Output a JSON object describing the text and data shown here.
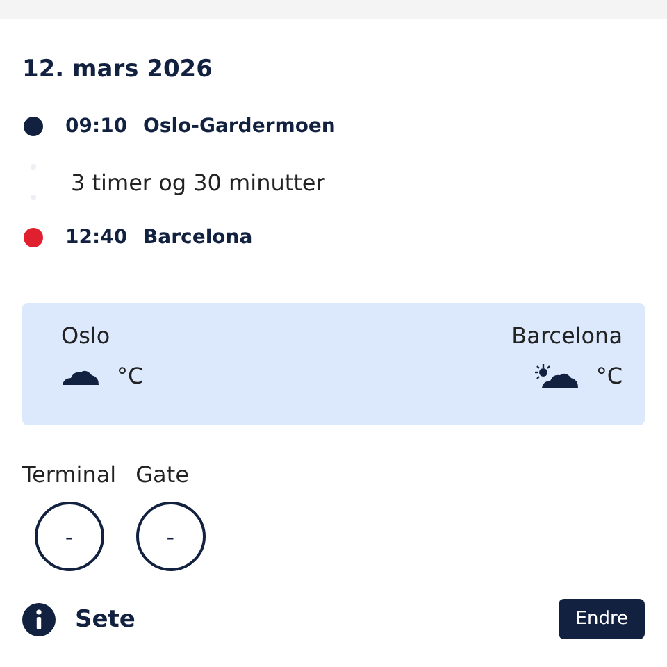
{
  "date": "12. mars 2026",
  "timeline": [
    {
      "kind": "stop",
      "time": "09:10",
      "place": "Oslo-Gardermoen",
      "color": "#12213f"
    },
    {
      "kind": "duration",
      "text": "3 timer og 30 minutter"
    },
    {
      "kind": "stop",
      "time": "12:40",
      "place": "Barcelona",
      "color": "#e0202e"
    }
  ],
  "weather": [
    {
      "kind": "cloud",
      "city": "Oslo",
      "unit": "°C"
    },
    {
      "kind": "suncloud",
      "city": "Barcelona",
      "unit": "°C"
    }
  ],
  "gates": [
    {
      "label": "Terminal",
      "value": "-"
    },
    {
      "label": "Gate",
      "value": "-"
    }
  ],
  "seat": {
    "title": "Sete",
    "button": "Endre"
  }
}
